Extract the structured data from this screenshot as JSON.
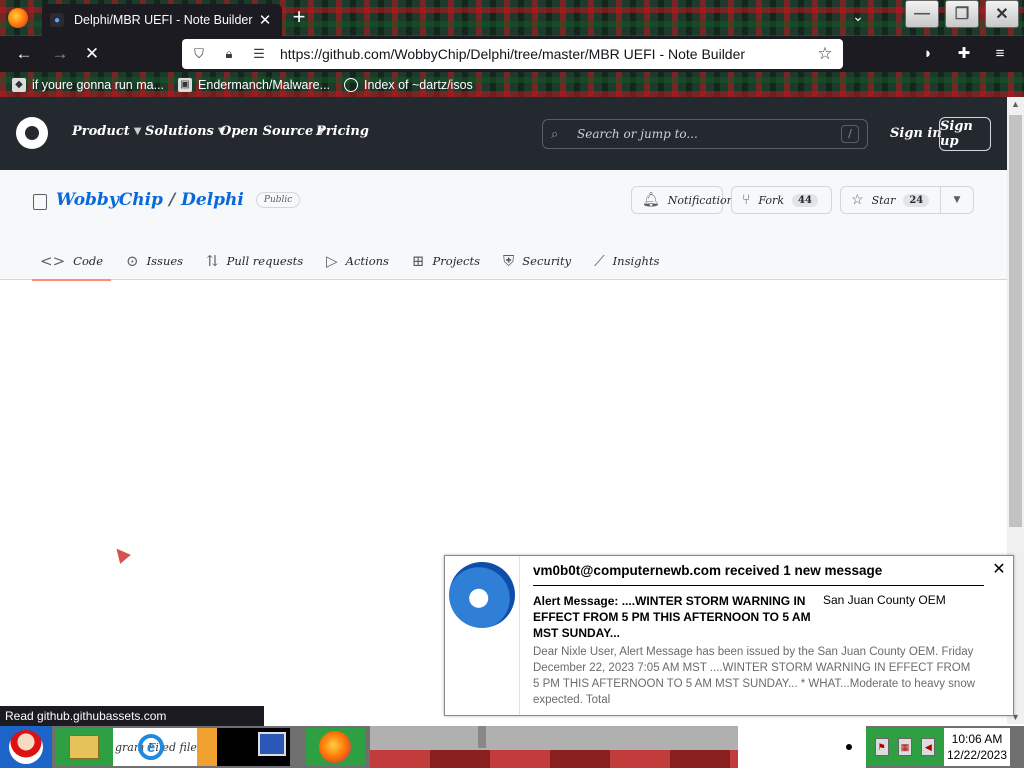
{
  "browser": {
    "tab_title": "Delphi/MBR UEFI - Note Builder at",
    "url": "https://github.com/WobbyChip/Delphi/tree/master/MBR UEFI - Note Builder",
    "bookmarks": [
      {
        "label": "if youre gonna run ma..."
      },
      {
        "label": "Endermanch/Malware..."
      },
      {
        "label": "Index of ~dartz/isos"
      }
    ],
    "status_text": "Read github.githubassets.com"
  },
  "github": {
    "nav": [
      "Product",
      "Solutions",
      "Open Source",
      "Pricing"
    ],
    "search_placeholder": "Search or jump to...",
    "search_shortcut": "/",
    "sign_in": "Sign in",
    "sign_up": "Sign up",
    "repo_owner": "WobbyChip",
    "repo_sep": "/",
    "repo_name": "Delphi",
    "visibility": "Public",
    "notifications_label": "Notifications",
    "fork_label": "Fork",
    "fork_count": "44",
    "star_label": "Star",
    "star_count": "24",
    "tabs": [
      "Code",
      "Issues",
      "Pull requests",
      "Actions",
      "Projects",
      "Security",
      "Insights"
    ]
  },
  "notification": {
    "header": "vm0b0t@computernewb.com received 1 new message",
    "subject": "Alert Message: ....WINTER STORM WARNING IN EFFECT FROM 5 PM THIS AFTERNOON TO 5 AM MST SUNDAY...",
    "sender": "San Juan County OEM",
    "body": "Dear Nixle User, Alert Message has been issued by the San Juan County OEM. Friday December 22, 2023 7:05 AM MST ....WINTER STORM WARNING IN EFFECT FROM 5 PM THIS AFTERNOON TO 5 AM MST SUNDAY... * WHAT...Moderate to heavy snow expected. Total"
  },
  "taskbar": {
    "label_text": "gram Fi    ed files",
    "time": "10:06 AM",
    "date": "12/22/2023"
  },
  "colors": {
    "gh_header": "#24292f",
    "link_blue": "#0969da",
    "active_tab_underline": "#fd8c73"
  }
}
